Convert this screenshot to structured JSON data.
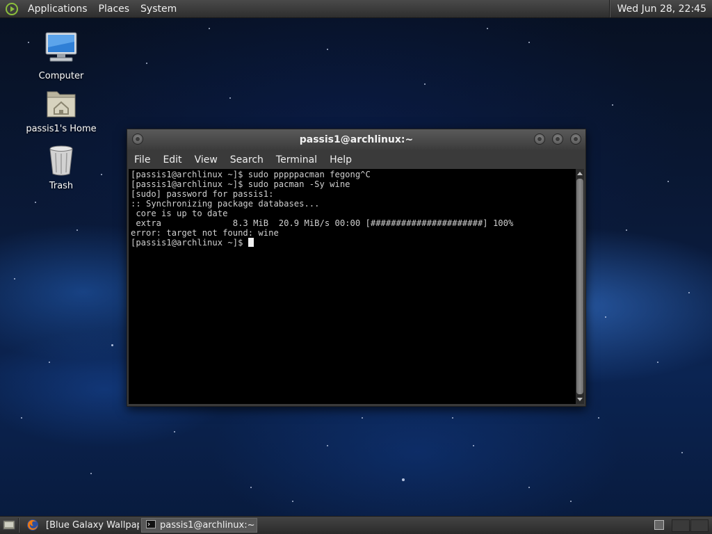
{
  "top_panel": {
    "menus": [
      "Applications",
      "Places",
      "System"
    ],
    "clock": "Wed Jun 28, 22:45"
  },
  "desktop_icons": [
    {
      "label": "Computer",
      "icon": "computer-icon"
    },
    {
      "label": "passis1's Home",
      "icon": "home-folder-icon"
    },
    {
      "label": "Trash",
      "icon": "trash-icon"
    }
  ],
  "terminal_window": {
    "title": "passis1@archlinux:~",
    "menu": [
      "File",
      "Edit",
      "View",
      "Search",
      "Terminal",
      "Help"
    ],
    "lines": [
      "[passis1@archlinux ~]$ sudo pppppacman fegong^C",
      "[passis1@archlinux ~]$ sudo pacman -Sy wine",
      "[sudo] password for passis1:",
      ":: Synchronizing package databases...",
      " core is up to date",
      " extra              8.3 MiB  20.9 MiB/s 00:00 [######################] 100%",
      "error: target not found: wine"
    ],
    "prompt": "[passis1@archlinux ~]$ "
  },
  "bottom_panel": {
    "tasks": [
      {
        "label": "[Blue Galaxy Wallpap...",
        "icon": "firefox-icon",
        "active": false
      },
      {
        "label": "passis1@archlinux:~",
        "icon": "terminal-icon",
        "active": true
      }
    ]
  },
  "colors": {
    "panel": "#3a3a3a",
    "terminal_bg": "#000000",
    "terminal_fg": "#cfcfcf",
    "distro_accent": "#8bbf3c"
  }
}
